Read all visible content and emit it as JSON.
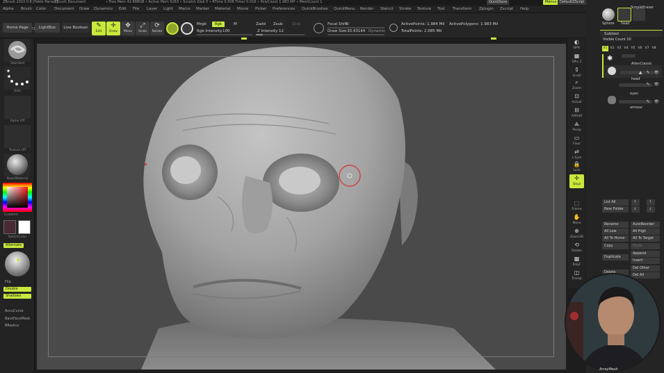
{
  "titlebar": {
    "app_info": "ZBrush 2022.0.8 [Pablo Parvez]",
    "document": "ZBrush Document",
    "mem": "• Free Mem 42.888GB • Active Mem 5263 • Scratch Disk 0 • RTime 0.508 Timer 0.016 • PolyCount 1.983 MP • MeshCount 1",
    "quicksave": "QuickSave",
    "menus_btn": "Menus",
    "default_script": "DefaultZScript",
    "help": "?"
  },
  "menubar": {
    "items": [
      "Alpha",
      "Brush",
      "Color",
      "Document",
      "Draw",
      "Dynamics",
      "Edit",
      "File",
      "Layer",
      "Light",
      "Macro",
      "Marker",
      "Material",
      "Movie",
      "Picker",
      "Preferences",
      "QuickBrushes",
      "QuickMenu",
      "Render",
      "Stencil",
      "Stroke",
      "Texture",
      "Tool",
      "Transform",
      "Zplugin",
      "Zscript",
      "Help"
    ]
  },
  "shelf": {
    "coord": "-0.632,0.429,-0.233",
    "home_page": "Home Page",
    "lightbox": "LightBox",
    "live_boolean": "Live Boolean",
    "tools": [
      {
        "label": "Edit",
        "icon": "edit-icon",
        "glyph": "✎"
      },
      {
        "label": "Draw",
        "icon": "draw-icon",
        "glyph": "✛"
      },
      {
        "label": "Move",
        "icon": "move-icon",
        "glyph": "✥"
      },
      {
        "label": "Scale",
        "icon": "scale-icon",
        "glyph": "⤢"
      },
      {
        "label": "Rotate",
        "icon": "rotate-icon",
        "glyph": "⟳"
      }
    ],
    "mrgb": "Mrgb",
    "rgb": "Rgb",
    "m": "M",
    "rgb_intensity_label": "Rgb Intensity",
    "rgb_intensity": "100",
    "zadd": "Zadd",
    "zsub": "Zsub",
    "zcut": "Zcut",
    "z_intensity_label": "Z Intensity",
    "z_intensity": "12",
    "focal_shift_label": "Focal Shift",
    "focal_shift": "0",
    "draw_size_label": "Draw Size",
    "draw_size": "30.43144",
    "dynamic": "Dynamic",
    "active_points": "ActivePoints: 1.984 Mil",
    "total_points": "TotalPoints: 2.085 Mil",
    "active_polygons": "ActivePolygons: 1.983 Mil"
  },
  "left_tray": {
    "standard": "Standard",
    "dots": "Dots",
    "alpha_off": "Alpha Off",
    "texture_off": "Texture Off",
    "basic_material": "BasicMaterial",
    "gradient": "Gradient",
    "switch_color": "SwitchColor",
    "alternate": "Alternate",
    "flip": "Flip",
    "double": "Double",
    "shadows": "Shadows",
    "accucurve": "AccuCurve",
    "backface_mask": "BackFaceMask",
    "bradius": "BRadius"
  },
  "right_tools": [
    {
      "label": "BPR",
      "glyph": "◐"
    },
    {
      "label": "SPix 3",
      "glyph": "▦"
    },
    {
      "label": "Scroll",
      "glyph": "⇕"
    },
    {
      "label": "Zoom",
      "glyph": "⌕"
    },
    {
      "label": "Actual",
      "glyph": "⊡"
    },
    {
      "label": "AAHalf",
      "glyph": "⊟"
    },
    {
      "label": "Persp",
      "glyph": "⟁"
    },
    {
      "label": "Floor",
      "glyph": "▭"
    },
    {
      "label": "L.Sym",
      "glyph": "⇄"
    },
    {
      "label": "Lock",
      "glyph": "🔒"
    },
    {
      "label": "Qxyz",
      "glyph": "✢"
    },
    {
      "label": "Frame",
      "glyph": "⬚"
    },
    {
      "label": "Move",
      "glyph": "✋"
    },
    {
      "label": "Zoom3D",
      "glyph": "⊕"
    },
    {
      "label": "Rotate",
      "glyph": "⟲"
    },
    {
      "label": "PolyF",
      "glyph": "▩"
    },
    {
      "label": "Transp",
      "glyph": "◫"
    }
  ],
  "right_panel": {
    "sphere": "Sphere",
    "head": "head",
    "simple_eraser": "SimpleEraser",
    "subtool": "Subtool",
    "visible_count": "Visible Count 10",
    "vtabs": [
      "V1",
      "V2",
      "V3",
      "V4",
      "V5",
      "V6",
      "V7",
      "V8"
    ],
    "subtools": [
      {
        "name": "AlienClassic"
      },
      {
        "name": "head"
      },
      {
        "name": "eyes"
      },
      {
        "name": "armour"
      }
    ],
    "list_all": "List All",
    "new_folder": "New Folder",
    "rename": "Rename",
    "auto_reorder": "AutoReorder",
    "all_low": "All Low",
    "all_high": "All High",
    "all_to_home": "All To Home",
    "all_to_target": "All To Target",
    "copy": "Copy",
    "paste": "Paste",
    "duplicate": "Duplicate",
    "append": "Append",
    "insert": "Insert",
    "del_other": "Del Other",
    "del_all": "Del All",
    "delete": "Delete"
  },
  "webcam_name": "ArrayMesh",
  "colors": {
    "accent": "#c8e83c",
    "bg": "#1d1d1d",
    "canvas": "#4a4a4a"
  }
}
